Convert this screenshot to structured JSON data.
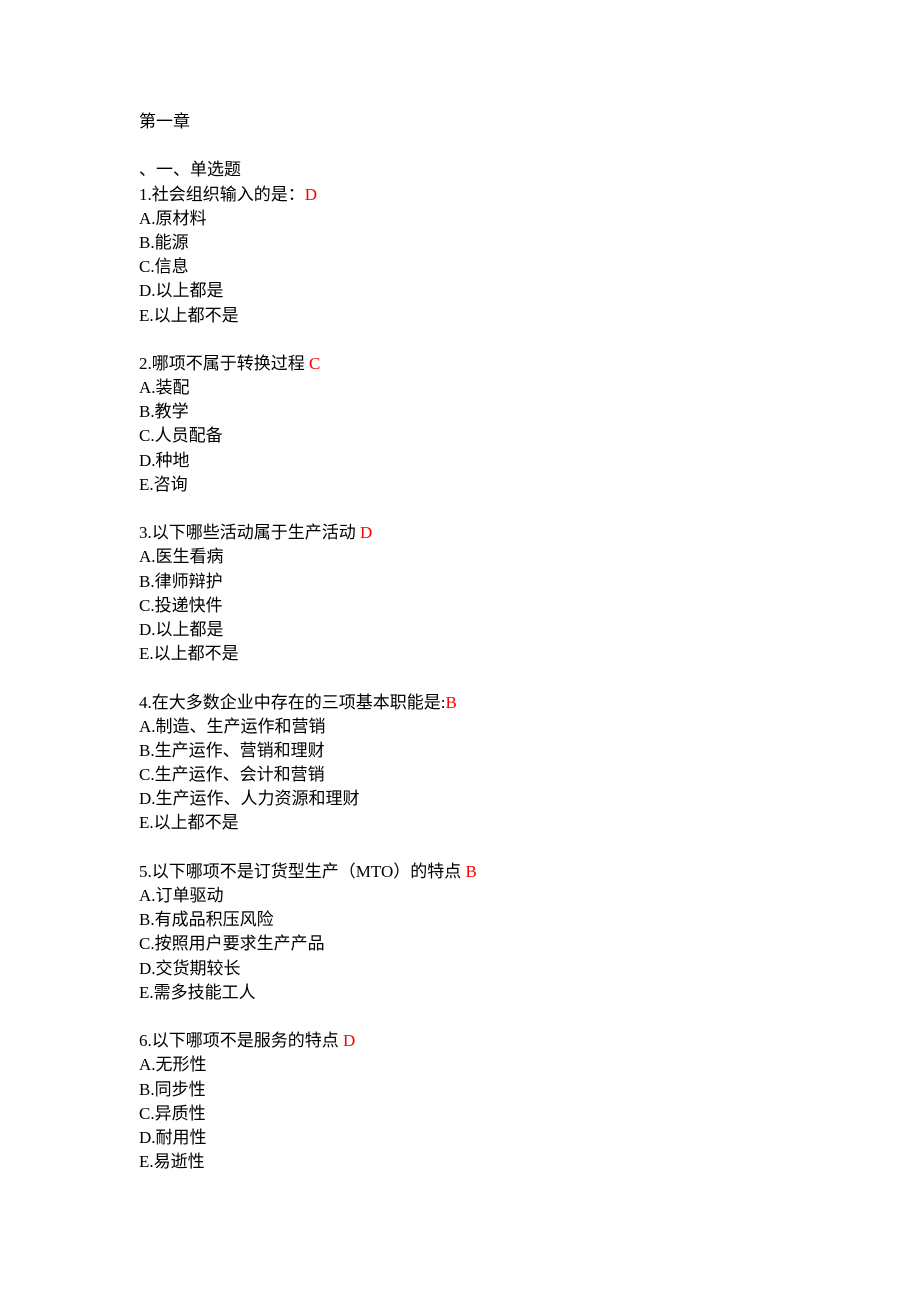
{
  "document": {
    "chapter_title": "第一章",
    "section_title": "、一、单选题",
    "answer_color": "#ff0000",
    "questions": [
      {
        "stem": "1.社会组织输入的是：",
        "answer": "D",
        "options": [
          "A.原材料",
          "B.能源",
          "C.信息",
          "D.以上都是",
          "E.以上都不是"
        ]
      },
      {
        "stem": "2.哪项不属于转换过程 ",
        "answer": "C",
        "options": [
          "A.装配",
          "B.教学",
          "C.人员配备",
          "D.种地",
          "E.咨询"
        ]
      },
      {
        "stem": "3.以下哪些活动属于生产活动 ",
        "answer": "D",
        "options": [
          "A.医生看病",
          "B.律师辩护",
          "C.投递快件",
          "D.以上都是",
          "E.以上都不是"
        ]
      },
      {
        "stem": "4.在大多数企业中存在的三项基本职能是:",
        "answer": "B",
        "options": [
          "A.制造、生产运作和营销",
          "B.生产运作、营销和理财",
          "C.生产运作、会计和营销",
          "D.生产运作、人力资源和理财",
          "E.以上都不是"
        ]
      },
      {
        "stem": "5.以下哪项不是订货型生产（MTO）的特点 ",
        "answer": "B",
        "options": [
          "A.订单驱动",
          "B.有成品积压风险",
          "C.按照用户要求生产产品",
          "D.交货期较长",
          "E.需多技能工人"
        ]
      },
      {
        "stem": "6.以下哪项不是服务的特点 ",
        "answer": "D",
        "options": [
          "A.无形性",
          "B.同步性",
          "C.异质性",
          "D.耐用性",
          "E.易逝性"
        ]
      }
    ]
  }
}
